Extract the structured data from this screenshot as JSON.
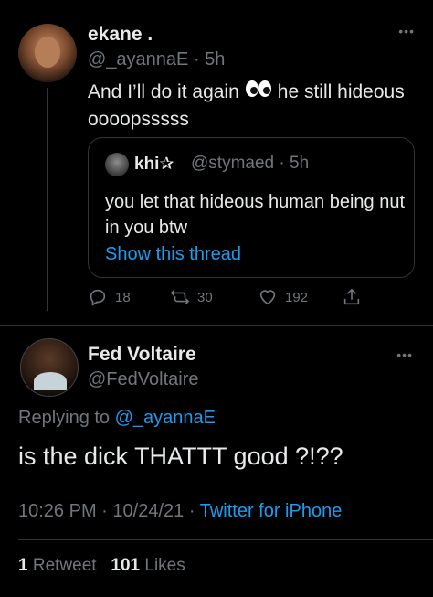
{
  "quoted_by": {
    "name": "ekane .",
    "handle": "@_ayannaE",
    "time": "· 5h",
    "text_before_emoji": "And I’ll do it again",
    "text_after_emoji": "he still hideous oooopsssss",
    "emoji": "eyes-emoji",
    "quote": {
      "name": "khi",
      "name_glyph": "✰",
      "handle": "@stymaed",
      "time": "· 5h",
      "text": "you let that hideous human being nut in you btw",
      "link": "Show this thread"
    },
    "actions": {
      "replies": "18",
      "retweets": "30",
      "likes": "192"
    }
  },
  "main_tweet": {
    "name": "Fed Voltaire",
    "handle": "@FedVoltaire",
    "replying_prefix": "Replying to",
    "replying_handle": "@_ayannaE",
    "text": "is the dick THATTT good ?!??",
    "time": "10:26 PM",
    "date": "10/24/21",
    "source": "Twitter for iPhone",
    "retweet_count": "1",
    "retweet_label": "Retweet",
    "like_count": "101",
    "like_label": "Likes"
  },
  "more_glyph": "•••",
  "colors": {
    "background": "#000000",
    "text": "#e7e9ea",
    "muted": "#71767b",
    "link": "#1d9bf0",
    "border": "#2f3336"
  }
}
